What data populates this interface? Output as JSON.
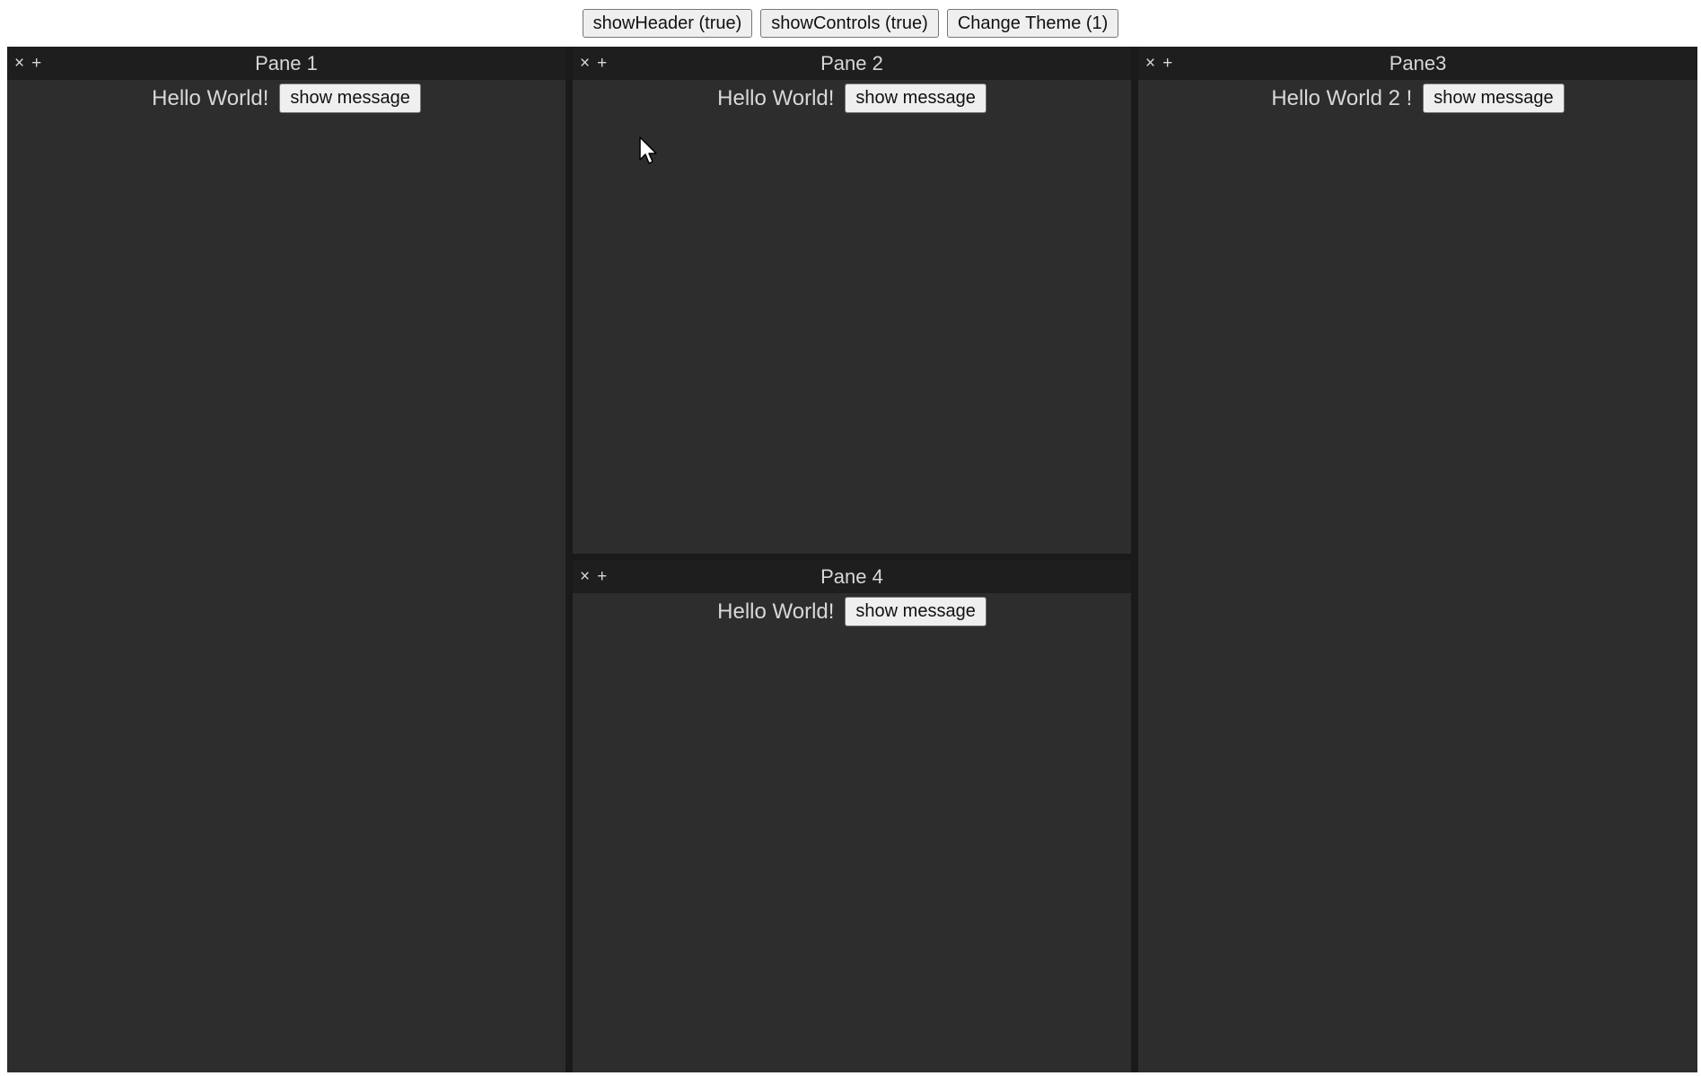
{
  "toolbar": {
    "show_header": "showHeader (true)",
    "show_controls": "showControls (true)",
    "change_theme": "Change Theme (1)"
  },
  "panes": [
    {
      "title": "Pane 1",
      "close": "×",
      "add": "+",
      "message": "Hello World!",
      "button": "show message"
    },
    {
      "title": "Pane 2",
      "close": "×",
      "add": "+",
      "message": "Hello World!",
      "button": "show message"
    },
    {
      "title": "Pane3",
      "close": "×",
      "add": "+",
      "message": "Hello World 2 !",
      "button": "show message"
    },
    {
      "title": "Pane 4",
      "close": "×",
      "add": "+",
      "message": "Hello World!",
      "button": "show message"
    }
  ],
  "colors": {
    "pane_background": "#2d2d2d",
    "header_background": "#1e1e1e",
    "text": "#d8d8d8",
    "separator": "#1a1a1a"
  },
  "icons": {
    "close": "close-icon",
    "add": "plus-icon",
    "pointer": "mouse-cursor-icon"
  }
}
